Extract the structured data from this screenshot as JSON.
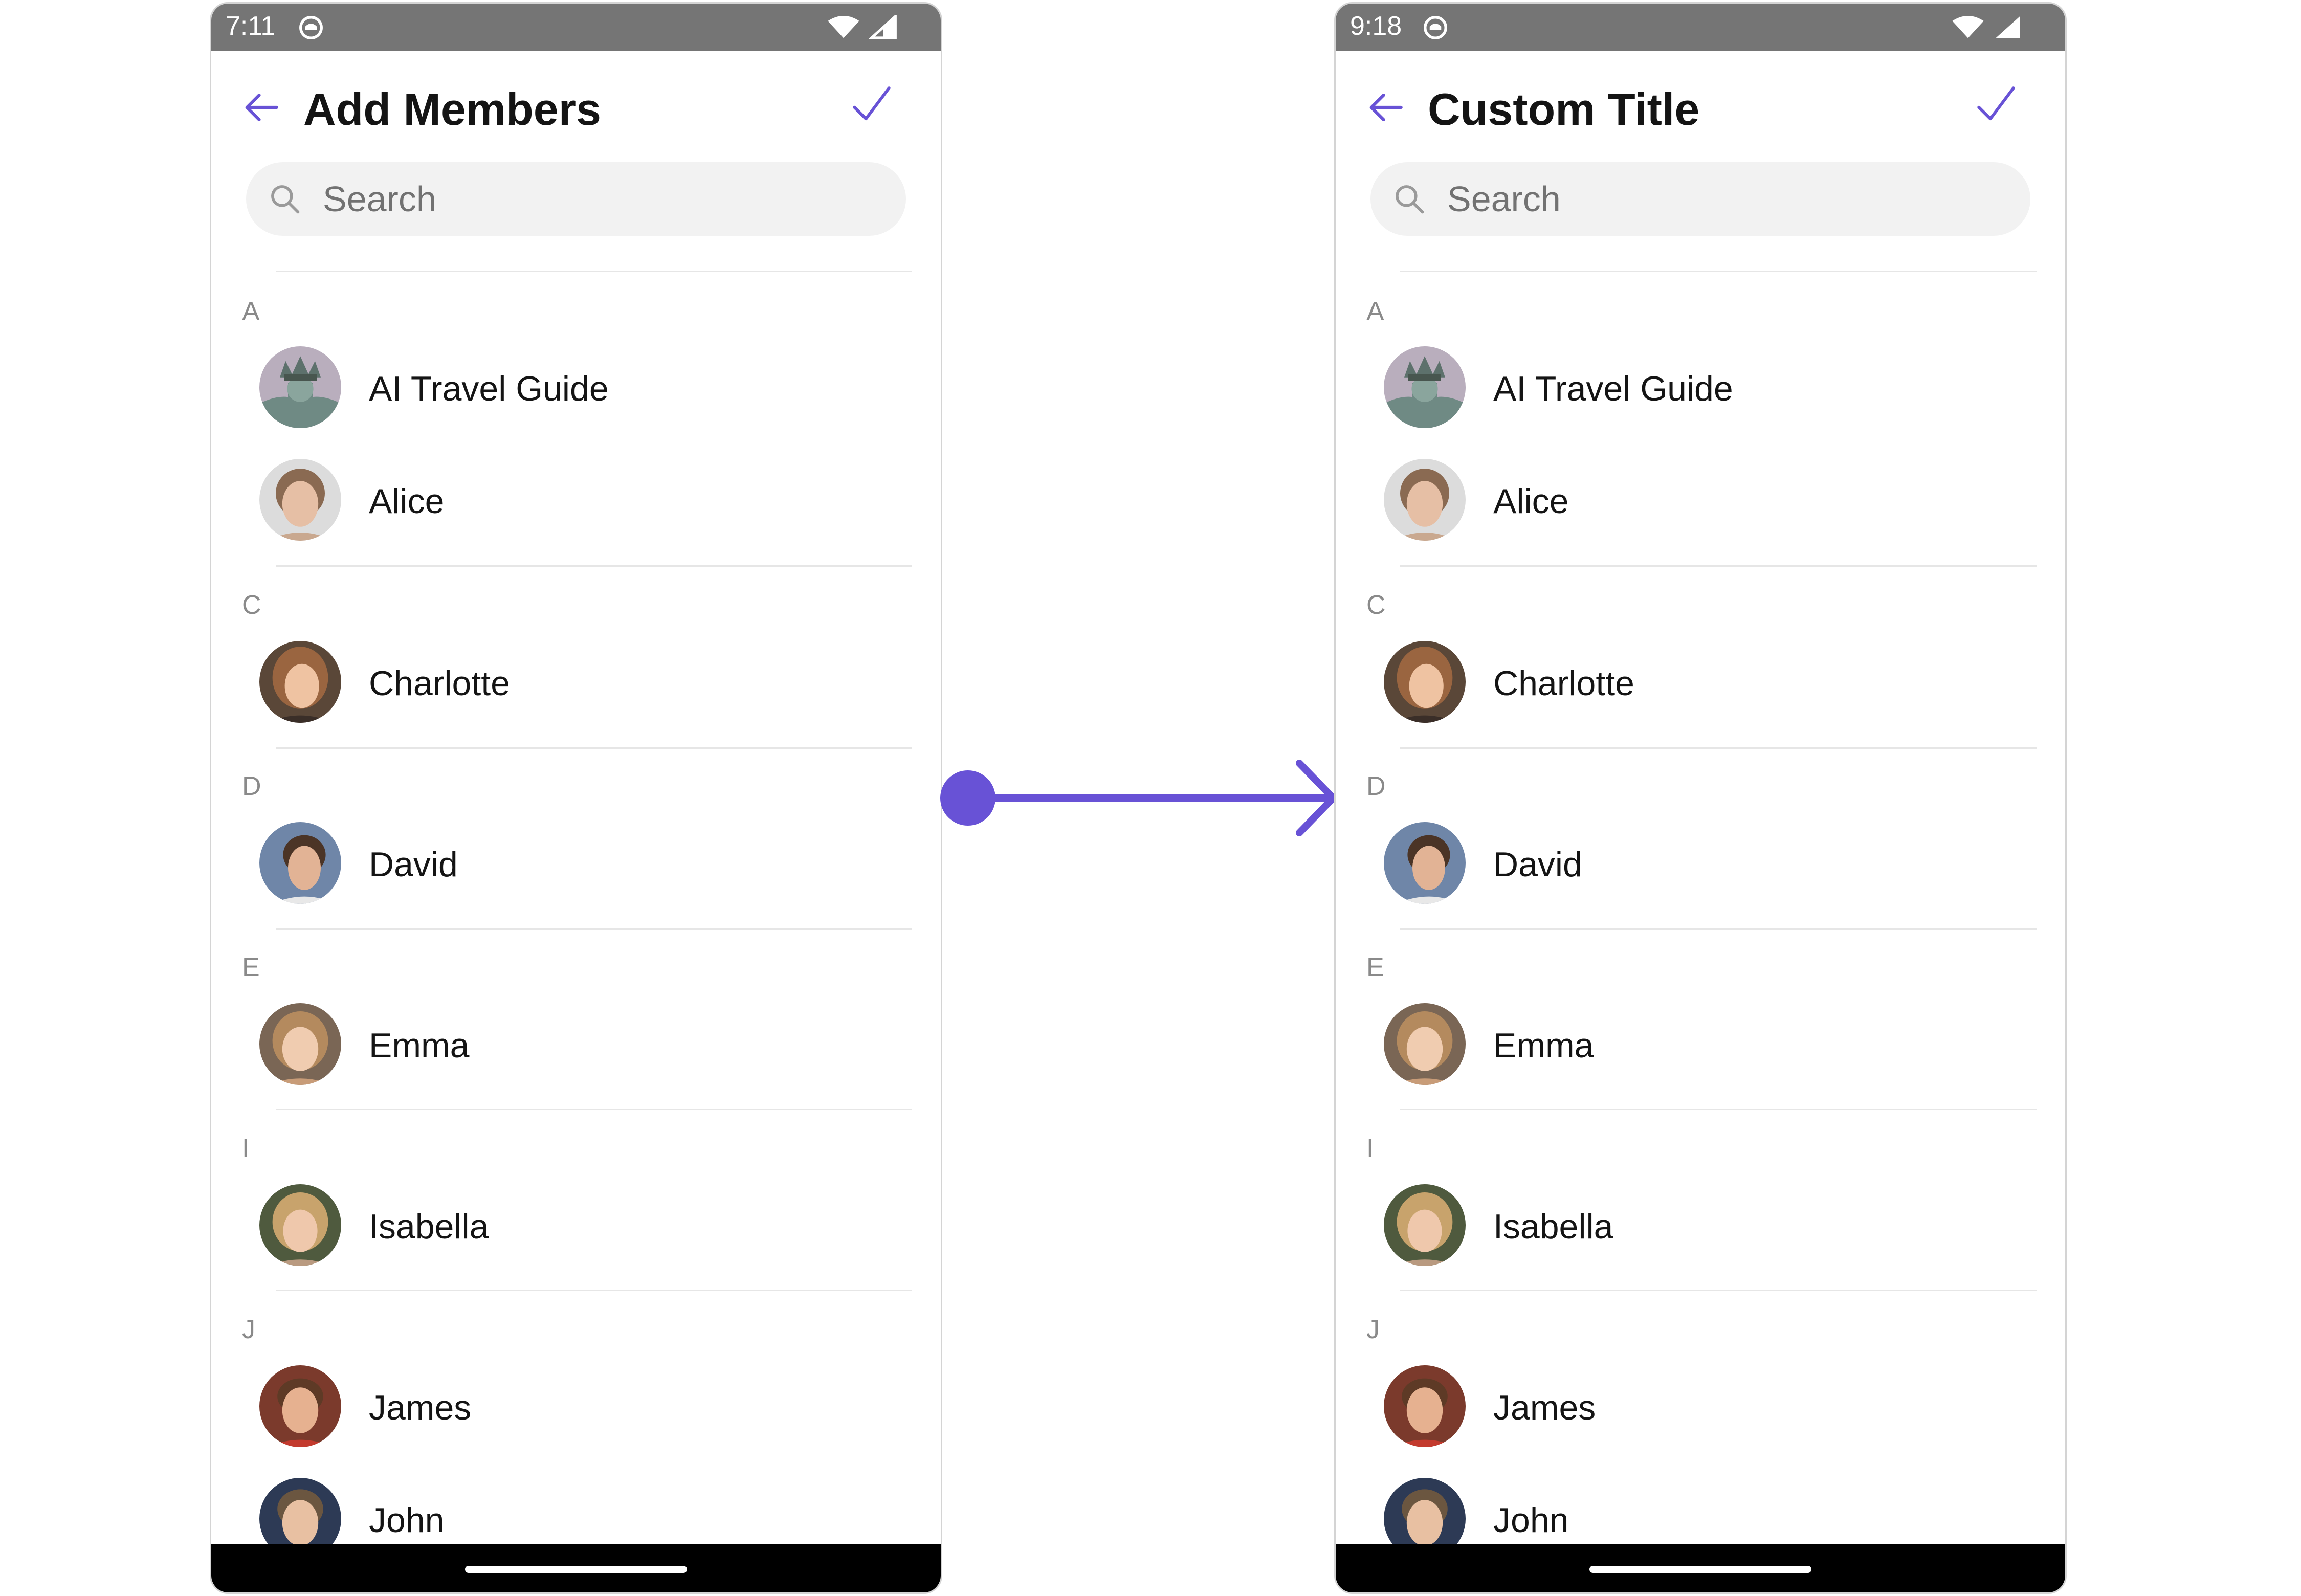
{
  "colors": {
    "accent": "#6852D6",
    "status_bar": "#757575",
    "nav_bar": "#000000",
    "search_bg": "#F2F2F2",
    "divider": "#E6E6E6",
    "section_letter": "#8A8A8A",
    "text_primary": "#141414"
  },
  "icons": {
    "back": "arrow-left-icon",
    "confirm": "checkmark-icon",
    "search": "search-icon",
    "notification": "notification-icon",
    "wifi": "wifi-icon",
    "signal": "cellular-signal-icon"
  },
  "screens": [
    {
      "status_bar": {
        "time": "7:11"
      },
      "app_bar": {
        "title": "Add Members"
      },
      "search": {
        "placeholder": "Search"
      },
      "sections": [
        {
          "letter": "A",
          "members": [
            {
              "name": "AI Travel Guide",
              "avatar": "statue-of-liberty"
            },
            {
              "name": "Alice",
              "avatar": "photo"
            }
          ]
        },
        {
          "letter": "C",
          "members": [
            {
              "name": "Charlotte",
              "avatar": "photo"
            }
          ]
        },
        {
          "letter": "D",
          "members": [
            {
              "name": "David",
              "avatar": "photo"
            }
          ]
        },
        {
          "letter": "E",
          "members": [
            {
              "name": "Emma",
              "avatar": "photo"
            }
          ]
        },
        {
          "letter": "I",
          "members": [
            {
              "name": "Isabella",
              "avatar": "photo"
            }
          ]
        },
        {
          "letter": "J",
          "members": [
            {
              "name": "James",
              "avatar": "photo"
            },
            {
              "name": "John",
              "avatar": "photo"
            }
          ]
        }
      ]
    },
    {
      "status_bar": {
        "time": "9:18"
      },
      "app_bar": {
        "title": "Custom Title"
      },
      "search": {
        "placeholder": "Search"
      },
      "sections": [
        {
          "letter": "A",
          "members": [
            {
              "name": "AI Travel Guide",
              "avatar": "statue-of-liberty"
            },
            {
              "name": "Alice",
              "avatar": "photo"
            }
          ]
        },
        {
          "letter": "C",
          "members": [
            {
              "name": "Charlotte",
              "avatar": "photo"
            }
          ]
        },
        {
          "letter": "D",
          "members": [
            {
              "name": "David",
              "avatar": "photo"
            }
          ]
        },
        {
          "letter": "E",
          "members": [
            {
              "name": "Emma",
              "avatar": "photo"
            }
          ]
        },
        {
          "letter": "I",
          "members": [
            {
              "name": "Isabella",
              "avatar": "photo"
            }
          ]
        },
        {
          "letter": "J",
          "members": [
            {
              "name": "James",
              "avatar": "photo"
            },
            {
              "name": "John",
              "avatar": "photo"
            }
          ]
        }
      ]
    }
  ]
}
